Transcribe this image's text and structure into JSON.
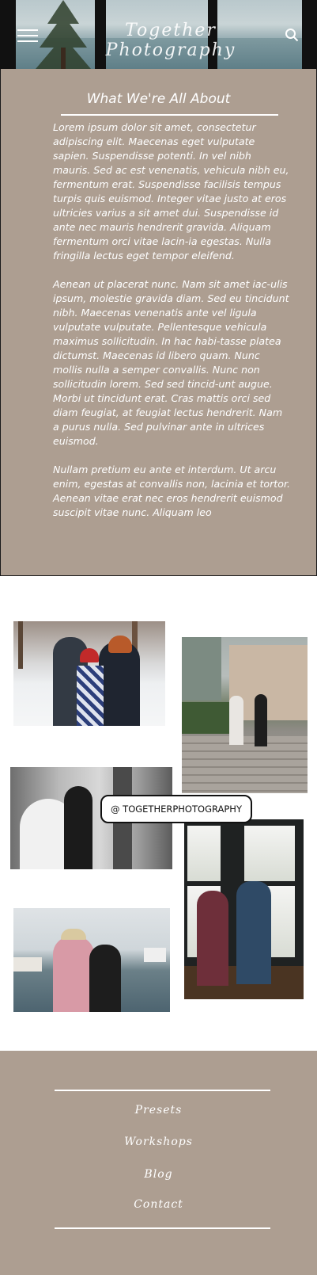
{
  "header": {
    "brand": "Together Photography",
    "menu_icon": "hamburger-menu-icon",
    "search_icon": "search-icon"
  },
  "about": {
    "title": "What We're All About",
    "paragraphs": [
      "Lorem ipsum dolor sit amet, consectetur adipiscing elit. Maecenas eget vulputate sapien. Suspendisse potenti. In vel nibh mauris. Sed ac est venenatis, vehicula nibh eu, fermentum erat. Suspendisse facilisis tempus turpis quis euismod. Integer vitae justo at eros ultricies varius a sit amet dui. Suspendisse id ante nec mauris hendrerit gravida. Aliquam fermentum orci vitae lacin-ia egestas. Nulla fringilla lectus eget tempor eleifend.",
      "Aenean ut placerat nunc. Nam sit amet iac-ulis ipsum, molestie gravida diam. Sed eu tincidunt nibh. Maecenas venenatis ante vel ligula vulputate vulputate. Pellentesque vehicula maximus sollicitudin. In hac habi-tasse platea dictumst. Maecenas id libero quam. Nunc mollis nulla a semper convallis. Nunc non sollicitudin lorem. Sed sed tincid-unt augue. Morbi ut tincidunt erat. Cras mattis orci sed diam feugiat, at feugiat lectus hendrerit. Nam a purus nulla. Sed pulvinar ante in ultrices euismod.",
      "Nullam pretium eu ante et interdum. Ut arcu enim, egestas at convallis non, lacinia et tortor. Aenean vitae erat nec eros hendrerit euismod suscipit vitae nunc. Aliquam leo"
    ]
  },
  "gallery": {
    "instagram_tag": "@ TOGETHERPHOTOGRAPHY"
  },
  "footer": {
    "links": [
      "Presets",
      "Workshops",
      "Blog",
      "Contact"
    ]
  },
  "colors": {
    "taupe": "#ad9e91",
    "white": "#ffffff",
    "border": "#1a1a1a"
  }
}
